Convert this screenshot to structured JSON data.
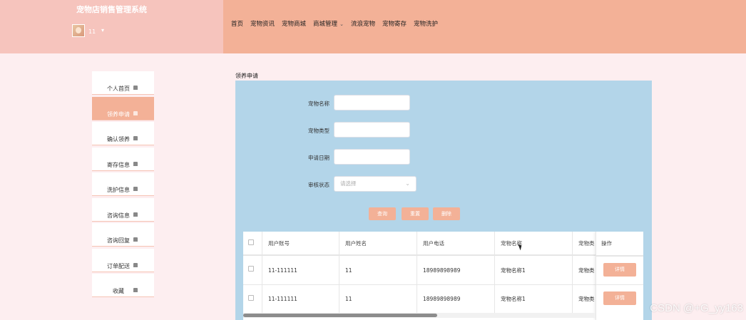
{
  "header": {
    "title": "宠物店销售管理系统",
    "username": "11",
    "user_caret": "▾",
    "nav": [
      "首页",
      "宠物资讯",
      "宠物商城",
      "商城管理",
      "流浪宠物",
      "宠物寄存",
      "宠物洗护"
    ],
    "nav_dropdown_index": 3
  },
  "sidebar": {
    "items": [
      {
        "label": "个人首页",
        "active": false
      },
      {
        "label": "领养申请",
        "active": true
      },
      {
        "label": "确认领养",
        "active": false
      },
      {
        "label": "寄存信息",
        "active": false
      },
      {
        "label": "洗护信息",
        "active": false
      },
      {
        "label": "咨询信息",
        "active": false
      },
      {
        "label": "咨询回复",
        "active": false
      },
      {
        "label": "订单配送",
        "active": false
      },
      {
        "label": "收藏",
        "active": false
      }
    ]
  },
  "main": {
    "breadcrumb": "领养申请",
    "form": {
      "pet_name_label": "宠物名称",
      "pet_type_label": "宠物类型",
      "apply_date_label": "申请日期",
      "status_label": "审核状态",
      "status_placeholder": "请选择"
    },
    "buttons": {
      "search": "查询",
      "reset": "重置",
      "delete": "删除"
    },
    "table": {
      "columns": [
        "用户账号",
        "用户姓名",
        "用户电话",
        "宠物名称",
        "宠物类",
        "操作"
      ],
      "rows": [
        {
          "account": "11-111111",
          "name": "11",
          "phone": "18989898989",
          "pet_name": "宠物名称1",
          "pet_type": "宠物类",
          "action": "详情"
        },
        {
          "account": "11-111111",
          "name": "11",
          "phone": "18989898989",
          "pet_name": "宠物名称1",
          "pet_type": "宠物类",
          "action": "详情"
        }
      ]
    }
  },
  "watermark": "CSDN @+G_yy163",
  "colors": {
    "accent": "#f3b197",
    "brand_bg": "#f6c4bd",
    "page_bg": "#fdeef0",
    "panel_bg": "#b3d5e9"
  }
}
